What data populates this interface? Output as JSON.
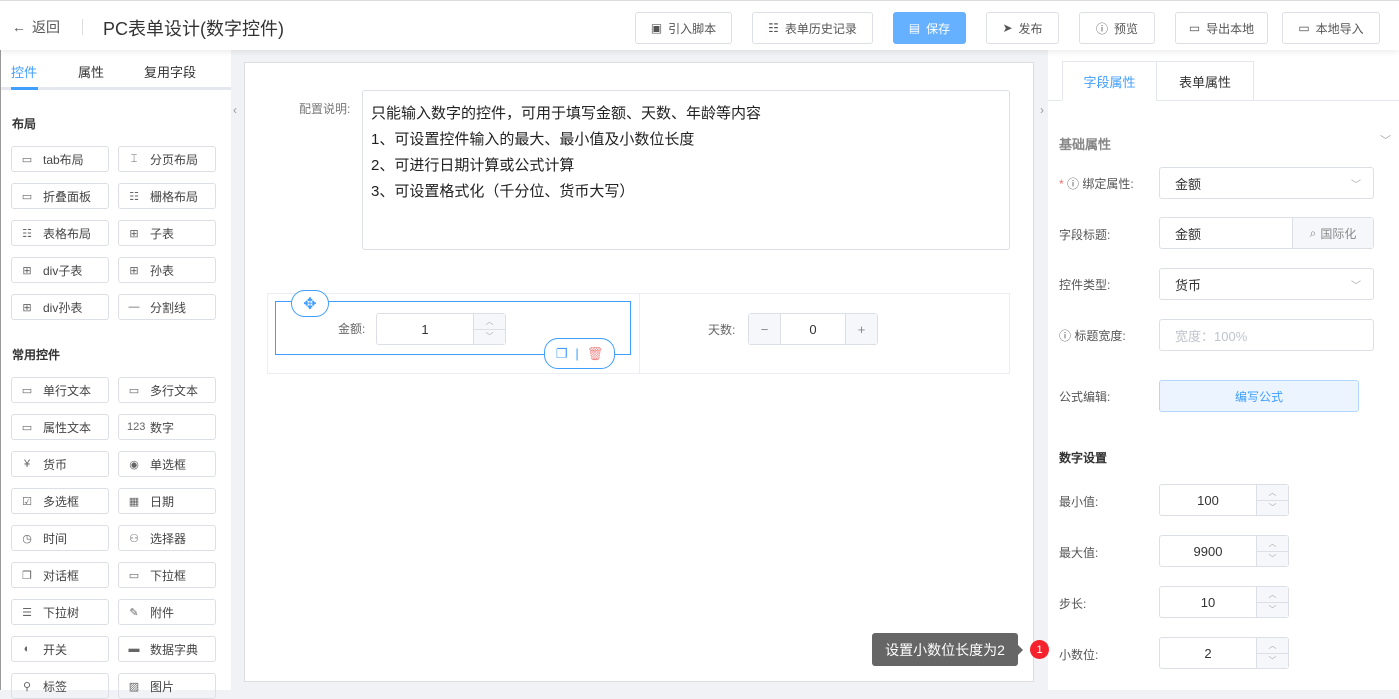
{
  "header": {
    "back": "返回",
    "title": "PC表单设计(数字控件)",
    "buttons": [
      "引入脚本",
      "表单历史记录",
      "保存",
      "发布",
      "预览",
      "导出本地",
      "本地导入"
    ]
  },
  "left": {
    "tabs": [
      "控件",
      "属性",
      "复用字段"
    ],
    "layout_title": "布局",
    "layout": [
      "tab布局",
      "分页布局",
      "折叠面板",
      "栅格布局",
      "表格布局",
      "子表",
      "div子表",
      "孙表",
      "div孙表",
      "分割线"
    ],
    "common_title": "常用控件",
    "common": [
      "单行文本",
      "多行文本",
      "属性文本",
      "数字",
      "货币",
      "单选框",
      "多选框",
      "日期",
      "时间",
      "选择器",
      "对话框",
      "下拉框",
      "下拉树",
      "附件",
      "开关",
      "数据字典",
      "标签",
      "图片"
    ]
  },
  "canvas": {
    "config_label": "配置说明:",
    "config_lines": [
      "只能输入数字的控件，可用于填写金额、天数、年龄等内容",
      "1、可设置控件输入的最大、最小值及小数位长度",
      "2、可进行日期计算或公式计算",
      "3、可设置格式化（千分位、货币大写）"
    ],
    "amount_label": "金额:",
    "amount_value": "1",
    "days_label": "天数:",
    "days_value": "0"
  },
  "right": {
    "tabs": [
      "字段属性",
      "表单属性"
    ],
    "basic_title": "基础属性",
    "bind_label": "绑定属性:",
    "bind_value": "金额",
    "field_title_label": "字段标题:",
    "field_title_value": "金额",
    "i18n": "国际化",
    "type_label": "控件类型:",
    "type_value": "货币",
    "width_label": "标题宽度:",
    "width_placeholder": "宽度：100%",
    "formula_label": "公式编辑:",
    "formula_button": "编写公式",
    "number_title": "数字设置",
    "min_label": "最小值:",
    "min": "100",
    "max_label": "最大值:",
    "max": "9900",
    "step_label": "步长:",
    "step": "10",
    "decimal_label": "小数位:",
    "decimal": "2"
  },
  "tooltip": {
    "text": "设置小数位长度为2",
    "badge": "1"
  }
}
